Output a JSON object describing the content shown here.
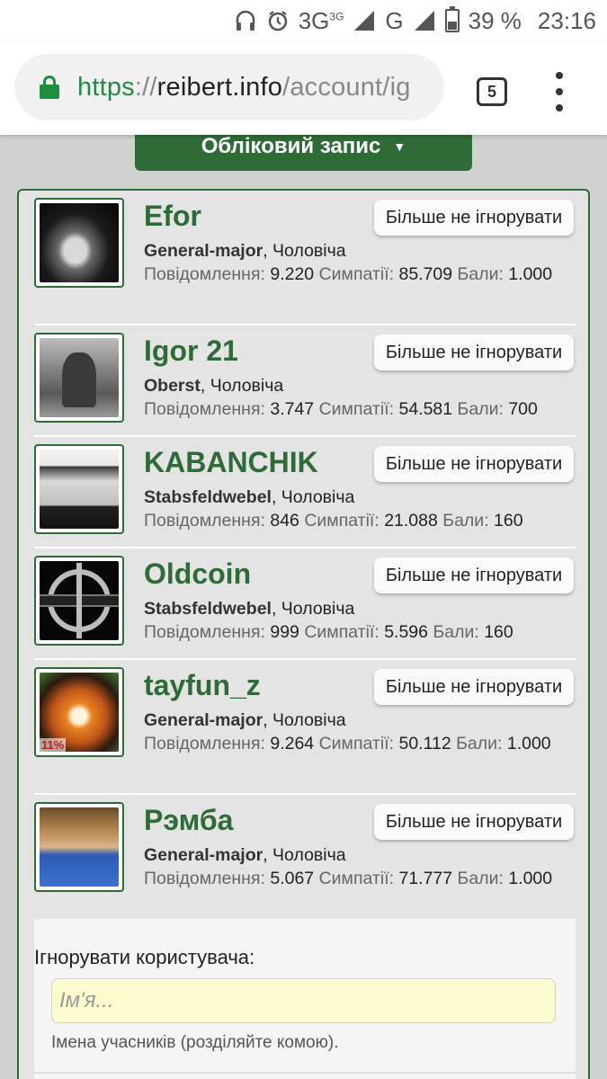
{
  "status_bar": {
    "icons": [
      "headphones-icon",
      "alarm-icon"
    ],
    "network_3g": "3G",
    "network_3g_sup": "3G",
    "network_g": "G",
    "battery": "39 %",
    "time": "23:16"
  },
  "browser": {
    "url_scheme": "https",
    "url_sep": "://",
    "url_host": "reibert.info",
    "url_path": "/account/ig",
    "tab_count": "5"
  },
  "page": {
    "account_button": "Обліковий запис",
    "unignore_label": "Більше не ігнорувати",
    "users": [
      {
        "name": "Efor",
        "rank": "General-major",
        "gender": ", Чоловіча",
        "messages_label": "Повідомлення:",
        "messages": "9.220",
        "likes_label": "Симпатії:",
        "likes": "85.709",
        "points_label": "Бали:",
        "points": "1.000"
      },
      {
        "name": "Igor 21",
        "rank": "Oberst",
        "gender": ", Чоловіча",
        "messages_label": "Повідомлення:",
        "messages": "3.747",
        "likes_label": "Симпатії:",
        "likes": "54.581",
        "points_label": "Бали:",
        "points": "700"
      },
      {
        "name": "KABANCHIK",
        "rank": "Stabsfeldwebel",
        "gender": ", Чоловіча",
        "messages_label": "Повідомлення:",
        "messages": "846",
        "likes_label": "Симпатії:",
        "likes": "21.088",
        "points_label": "Бали:",
        "points": "160"
      },
      {
        "name": "Oldcoin",
        "rank": "Stabsfeldwebel",
        "gender": ", Чоловіча",
        "messages_label": "Повідомлення:",
        "messages": "999",
        "likes_label": "Симпатії:",
        "likes": "5.596",
        "points_label": "Бали:",
        "points": "160"
      },
      {
        "name": "tayfun_z",
        "rank": "General-major",
        "gender": ", Чоловіча",
        "messages_label": "Повідомлення:",
        "messages": "9.264",
        "likes_label": "Симпатії:",
        "likes": "50.112",
        "points_label": "Бали:",
        "points": "1.000",
        "avatar_badge": "11%"
      },
      {
        "name": "Рэмба",
        "rank": "General-major",
        "gender": ", Чоловіча",
        "messages_label": "Повідомлення:",
        "messages": "5.067",
        "likes_label": "Симпатії:",
        "likes": "71.777",
        "points_label": "Бали:",
        "points": "1.000"
      }
    ],
    "ignore_form": {
      "label": "Ігнорувати користувача:",
      "placeholder": "Ім'я...",
      "hint": "Імена учасників (розділяйте комою)."
    }
  },
  "colors": {
    "accent_green": "#2e6b37",
    "url_green": "#1e8e3e",
    "input_bg": "#fefccf"
  }
}
